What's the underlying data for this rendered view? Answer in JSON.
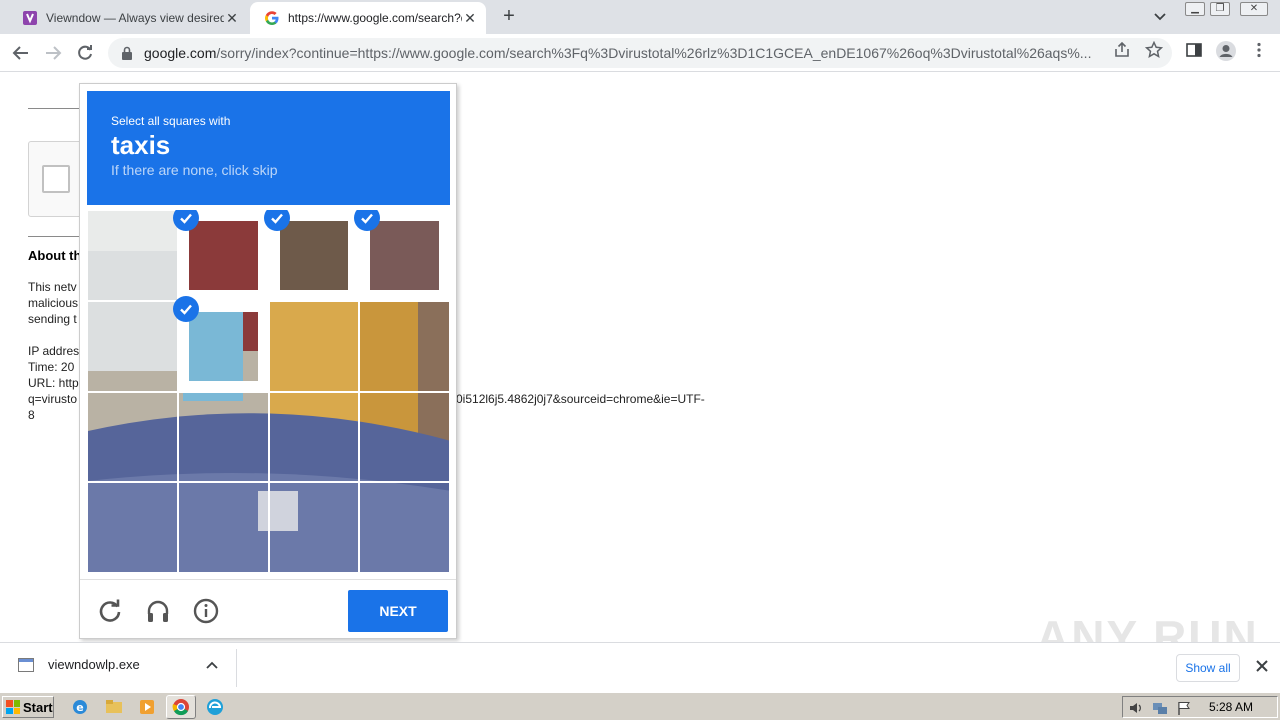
{
  "browser": {
    "tabs": [
      {
        "title": "Viewndow — Always view desired wi",
        "active": false,
        "favicon": "viewndow-favicon"
      },
      {
        "title": "https://www.google.com/search?q=",
        "active": true,
        "favicon": "google-favicon"
      }
    ],
    "new_tab_symbol": "+",
    "url_host": "google.com",
    "url_path": "/sorry/index?continue=https://www.google.com/search%3Fq%3Dvirustotal%26rlz%3D1C1GCEA_enDE1067%26oq%3Dvirustotal%26aqs%..."
  },
  "page": {
    "about_heading": "About th",
    "lines_a": [
      "This netv",
      "malicious",
      "sending t"
    ],
    "lines_b": [
      "IP addres",
      "Time: 20",
      "URL: http",
      "q=virusto"
    ],
    "url_tail": "0i512l6j5.4862j0j7&sourceid=chrome&ie=UTF-",
    "url_tail_2": "8"
  },
  "captcha": {
    "instruction": "Select all squares with",
    "target": "taxis",
    "hint": "If there are none, click skip",
    "grid": {
      "rows": 4,
      "cols": 4,
      "selected": [
        [
          0,
          1
        ],
        [
          0,
          2
        ],
        [
          0,
          3
        ],
        [
          1,
          1
        ]
      ]
    },
    "next_label": "NEXT",
    "colors": {
      "accent": "#1a73e8"
    }
  },
  "downloads": {
    "file_name": "viewndowlp.exe",
    "show_all_label": "Show all"
  },
  "watermark": "ANY RUN",
  "taskbar": {
    "start_label": "Start",
    "clock": "5:28 AM"
  }
}
